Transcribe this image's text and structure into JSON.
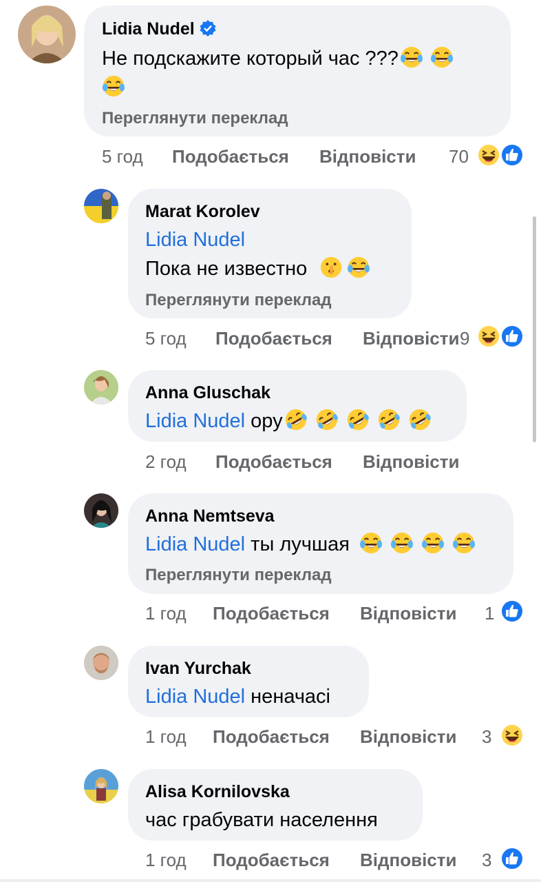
{
  "colors": {
    "mention": "#216fdb",
    "meta": "#65676b",
    "bubble": "#f0f2f5",
    "like_blue": "#1877f2"
  },
  "comments": [
    {
      "author": "Lidia Nudel",
      "verified": true,
      "text": "Не подскажите который час ???",
      "text_emojis": [
        "tears-of-joy-emoji",
        "tears-of-joy-emoji",
        "tears-of-joy-emoji"
      ],
      "translate": "Переглянути переклад",
      "time": "5 год",
      "like": "Подобається",
      "reply": "Відповісти",
      "reaction_count": "70",
      "reactions": [
        "haha-reaction-icon",
        "like-reaction-icon"
      ]
    },
    {
      "author": "Marat  Korolev",
      "mention": "Lidia Nudel",
      "text": "Пока не известно",
      "text_emojis": [
        "shushing-face-emoji",
        "tears-of-joy-emoji"
      ],
      "translate": "Переглянути переклад",
      "time": "5 год",
      "like": "Подобається",
      "reply": "Відповісти",
      "reaction_count": "9",
      "reactions": [
        "haha-reaction-icon",
        "like-reaction-icon"
      ]
    },
    {
      "author": "Anna Gluschak",
      "mention": "Lidia Nudel",
      "text": "ору",
      "text_emojis": [
        "rolling-laughing-emoji",
        "rolling-laughing-emoji",
        "rolling-laughing-emoji",
        "rolling-laughing-emoji",
        "rolling-laughing-emoji"
      ],
      "time": "2 год",
      "like": "Подобається",
      "reply": "Відповісти"
    },
    {
      "author": "Anna Nemtseva",
      "mention": "Lidia Nudel",
      "text": "ты лучшая",
      "text_emojis": [
        "tears-of-joy-emoji",
        "tears-of-joy-emoji",
        "tears-of-joy-emoji",
        "tears-of-joy-emoji"
      ],
      "translate": "Переглянути переклад",
      "time": "1 год",
      "like": "Подобається",
      "reply": "Відповісти",
      "reaction_count": "1",
      "reactions": [
        "like-reaction-icon"
      ]
    },
    {
      "author": "Ivan Yurchak",
      "mention": "Lidia Nudel",
      "text": "неначасі",
      "time": "1 год",
      "like": "Подобається",
      "reply": "Відповісти",
      "reaction_count": "3",
      "reactions": [
        "haha-reaction-icon"
      ]
    },
    {
      "author": "Alisa Kornilovska",
      "text": "час грабувати населення",
      "time": "1 год",
      "like": "Подобається",
      "reply": "Відповісти",
      "reaction_count": "3",
      "reactions": [
        "like-reaction-icon"
      ]
    }
  ]
}
